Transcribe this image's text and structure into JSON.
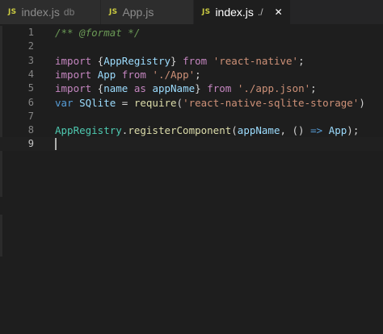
{
  "tabs": [
    {
      "icon": "JS",
      "name": "index.js",
      "description": "db",
      "active": false
    },
    {
      "icon": "JS",
      "name": "App.js",
      "description": "",
      "active": false
    },
    {
      "icon": "JS",
      "name": "index.js",
      "description": "./",
      "active": true,
      "close": "✕"
    }
  ],
  "editor": {
    "active_line": 9,
    "lines": [
      {
        "number": "1",
        "tokens": [
          {
            "c": "comment",
            "t": "/** @format */"
          }
        ]
      },
      {
        "number": "2",
        "tokens": []
      },
      {
        "number": "3",
        "tokens": [
          {
            "c": "kw",
            "t": "import"
          },
          {
            "c": "plain",
            "t": " {"
          },
          {
            "c": "name",
            "t": "AppRegistry"
          },
          {
            "c": "plain",
            "t": "} "
          },
          {
            "c": "kw",
            "t": "from"
          },
          {
            "c": "plain",
            "t": " "
          },
          {
            "c": "str",
            "t": "'react-native'"
          },
          {
            "c": "plain",
            "t": ";"
          }
        ]
      },
      {
        "number": "4",
        "tokens": [
          {
            "c": "kw",
            "t": "import"
          },
          {
            "c": "plain",
            "t": " "
          },
          {
            "c": "name",
            "t": "App"
          },
          {
            "c": "plain",
            "t": " "
          },
          {
            "c": "kw",
            "t": "from"
          },
          {
            "c": "plain",
            "t": " "
          },
          {
            "c": "str",
            "t": "'./App'"
          },
          {
            "c": "plain",
            "t": ";"
          }
        ]
      },
      {
        "number": "5",
        "tokens": [
          {
            "c": "kw",
            "t": "import"
          },
          {
            "c": "plain",
            "t": " {"
          },
          {
            "c": "name",
            "t": "name"
          },
          {
            "c": "plain",
            "t": " "
          },
          {
            "c": "kw",
            "t": "as"
          },
          {
            "c": "plain",
            "t": " "
          },
          {
            "c": "name",
            "t": "appName"
          },
          {
            "c": "plain",
            "t": "} "
          },
          {
            "c": "kw",
            "t": "from"
          },
          {
            "c": "plain",
            "t": " "
          },
          {
            "c": "str",
            "t": "'./app.json'"
          },
          {
            "c": "plain",
            "t": ";"
          }
        ]
      },
      {
        "number": "6",
        "tokens": [
          {
            "c": "var",
            "t": "var"
          },
          {
            "c": "plain",
            "t": " "
          },
          {
            "c": "name",
            "t": "SQlite"
          },
          {
            "c": "plain",
            "t": " = "
          },
          {
            "c": "fn",
            "t": "require"
          },
          {
            "c": "plain",
            "t": "("
          },
          {
            "c": "str",
            "t": "'react-native-sqlite-storage'"
          },
          {
            "c": "plain",
            "t": ")"
          }
        ]
      },
      {
        "number": "7",
        "tokens": []
      },
      {
        "number": "8",
        "tokens": [
          {
            "c": "type",
            "t": "AppRegistry"
          },
          {
            "c": "plain",
            "t": "."
          },
          {
            "c": "fn",
            "t": "registerComponent"
          },
          {
            "c": "plain",
            "t": "("
          },
          {
            "c": "name",
            "t": "appName"
          },
          {
            "c": "plain",
            "t": ", () "
          },
          {
            "c": "op",
            "t": "=>"
          },
          {
            "c": "plain",
            "t": " "
          },
          {
            "c": "name",
            "t": "App"
          },
          {
            "c": "plain",
            "t": ");"
          }
        ]
      },
      {
        "number": "9",
        "tokens": []
      }
    ]
  },
  "colors": {
    "editor_bg": "#1e1e1e",
    "tab_inactive_bg": "#2d2d2d",
    "js_icon": "#cbcb41",
    "comment": "#6a9955",
    "keyword": "#c586c0",
    "string": "#ce9178",
    "variable": "#9cdcfe",
    "function": "#dcdcaa",
    "class": "#4ec9b0"
  }
}
